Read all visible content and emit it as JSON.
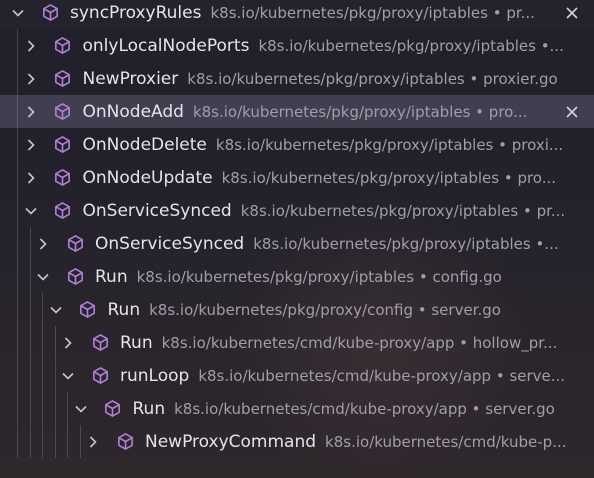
{
  "colors": {
    "symbol_purple": "#b180d7",
    "row_highlight": "#4f4a62",
    "name_text": "#e6e3ea",
    "description_text": "#a19ea8"
  },
  "icons": {
    "expanded": "chevron-down-icon",
    "collapsed": "chevron-right-icon",
    "symbol": "symbol-method-cube-icon",
    "dismiss": "close-icon"
  },
  "items": [
    {
      "name": "syncProxyRules",
      "desc": "k8s.io/kubernetes/pkg/proxy/iptables • pr...",
      "depth": 0,
      "expanded": true,
      "close": true
    },
    {
      "name": "onlyLocalNodePorts",
      "desc": "k8s.io/kubernetes/pkg/proxy/iptables •...",
      "depth": 1,
      "expanded": false
    },
    {
      "name": "NewProxier",
      "desc": "k8s.io/kubernetes/pkg/proxy/iptables • proxier.go",
      "depth": 1,
      "expanded": false
    },
    {
      "name": "OnNodeAdd",
      "desc": "k8s.io/kubernetes/pkg/proxy/iptables • pro...",
      "depth": 1,
      "expanded": false,
      "highlight": true,
      "close": true
    },
    {
      "name": "OnNodeDelete",
      "desc": "k8s.io/kubernetes/pkg/proxy/iptables • proxi...",
      "depth": 1,
      "expanded": false
    },
    {
      "name": "OnNodeUpdate",
      "desc": "k8s.io/kubernetes/pkg/proxy/iptables • pro...",
      "depth": 1,
      "expanded": false
    },
    {
      "name": "OnServiceSynced",
      "desc": "k8s.io/kubernetes/pkg/proxy/iptables • pr...",
      "depth": 1,
      "expanded": true
    },
    {
      "name": "OnServiceSynced",
      "desc": "k8s.io/kubernetes/pkg/proxy/iptables •...",
      "depth": 2,
      "expanded": false
    },
    {
      "name": "Run",
      "desc": "k8s.io/kubernetes/pkg/proxy/iptables • config.go",
      "depth": 2,
      "expanded": true
    },
    {
      "name": "Run",
      "desc": "k8s.io/kubernetes/pkg/proxy/config • server.go",
      "depth": 3,
      "expanded": true
    },
    {
      "name": "Run",
      "desc": "k8s.io/kubernetes/cmd/kube-proxy/app • hollow_pr...",
      "depth": 4,
      "expanded": false
    },
    {
      "name": "runLoop",
      "desc": "k8s.io/kubernetes/cmd/kube-proxy/app • serve...",
      "depth": 4,
      "expanded": true
    },
    {
      "name": "Run",
      "desc": "k8s.io/kubernetes/cmd/kube-proxy/app • server.go",
      "depth": 5,
      "expanded": true
    },
    {
      "name": "NewProxyCommand",
      "desc": "k8s.io/kubernetes/cmd/kube-p...",
      "depth": 6,
      "expanded": false
    }
  ]
}
